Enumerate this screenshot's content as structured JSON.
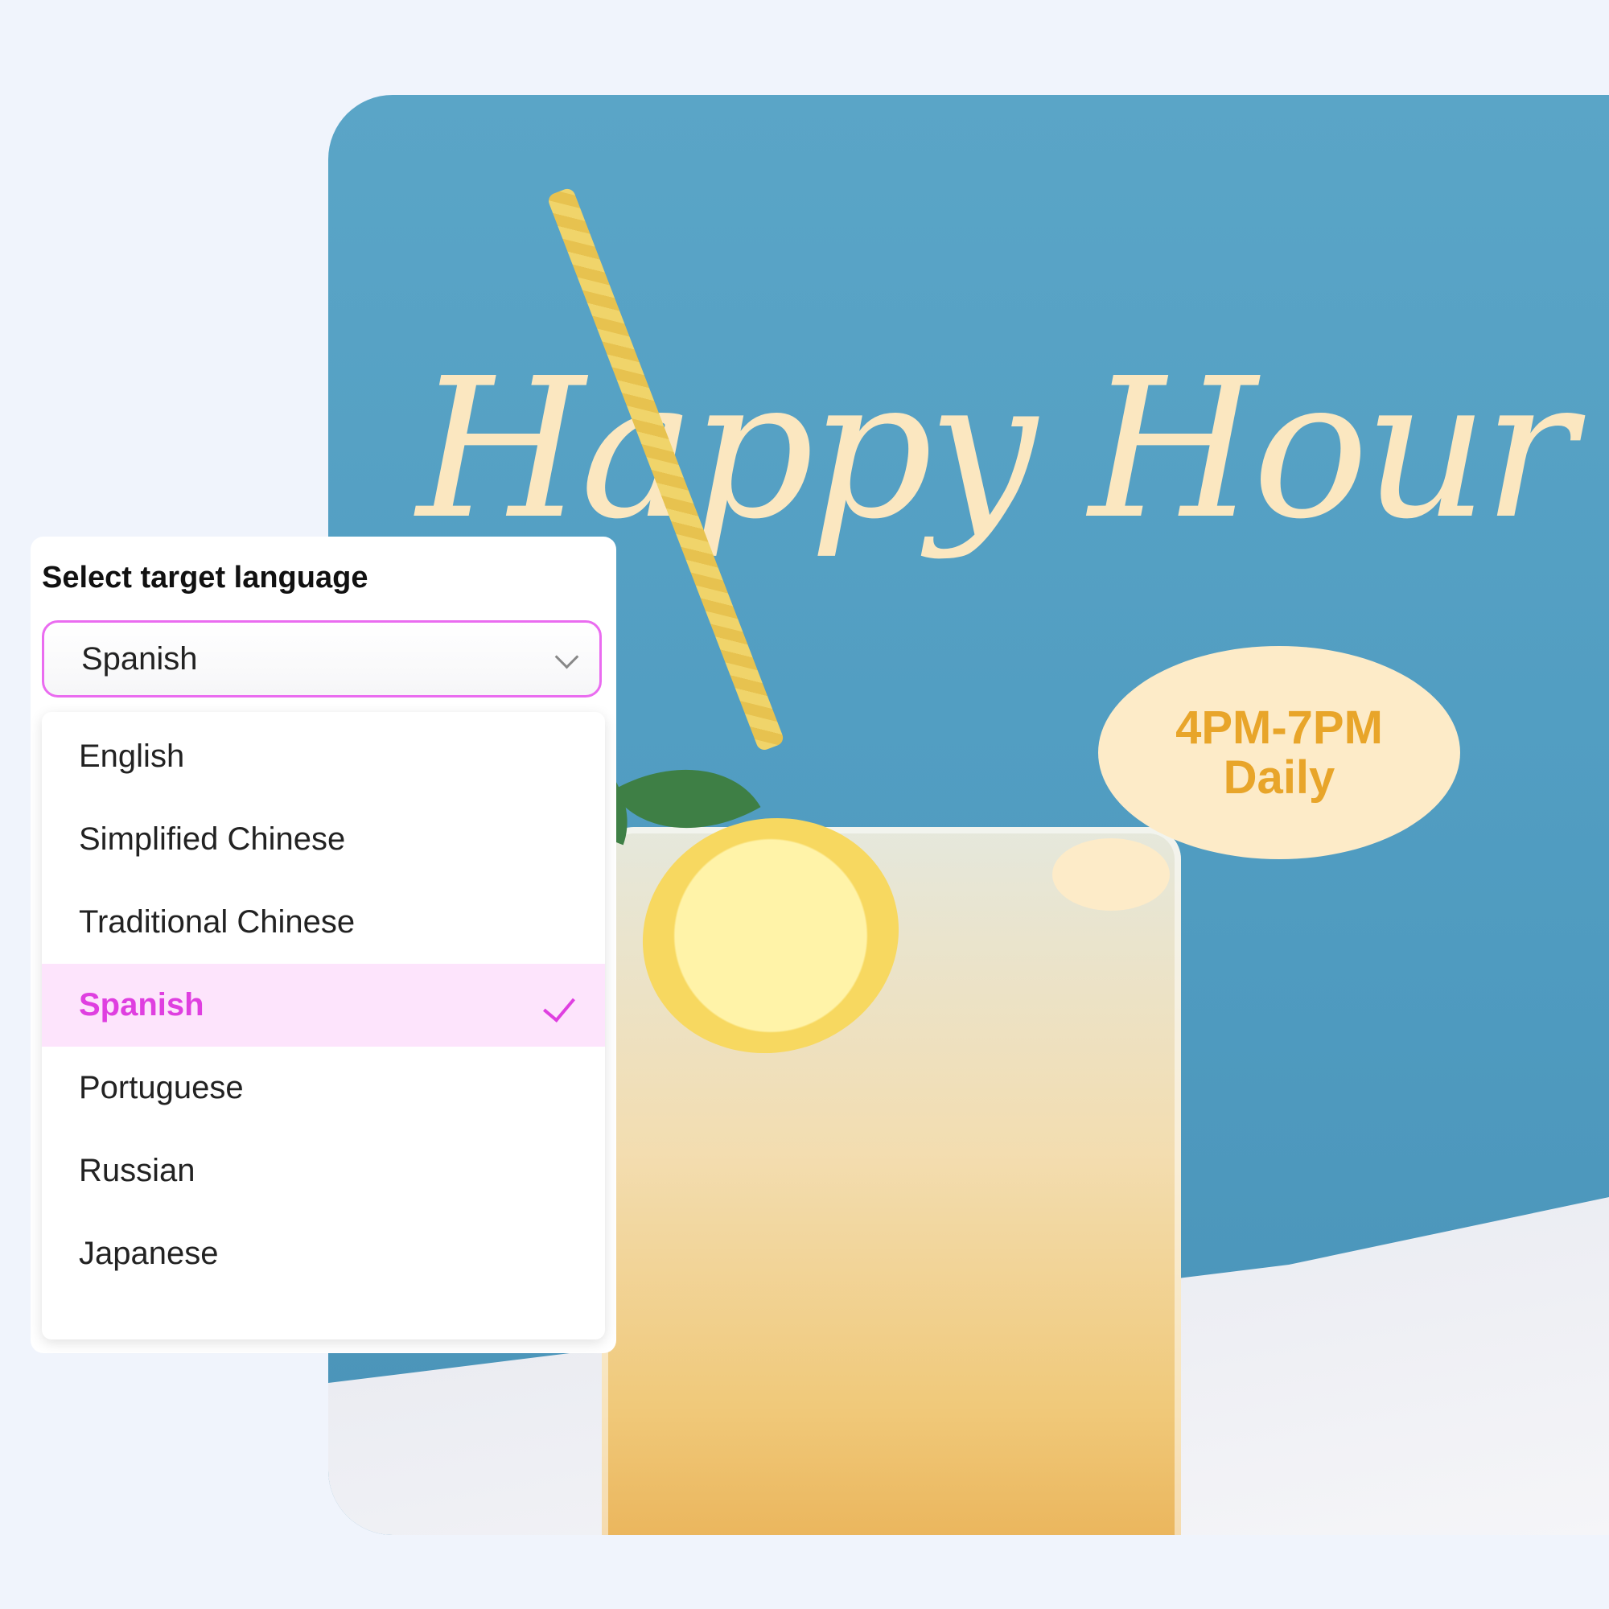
{
  "poster": {
    "headline": "Happy Hour",
    "badge_line1": "4PM-7PM",
    "badge_line2": "Daily"
  },
  "language_selector": {
    "label": "Select target language",
    "selected_value": "Spanish",
    "options": [
      {
        "label": "English",
        "selected": false
      },
      {
        "label": "Simplified Chinese",
        "selected": false
      },
      {
        "label": "Traditional Chinese",
        "selected": false
      },
      {
        "label": "Spanish",
        "selected": true
      },
      {
        "label": "Portuguese",
        "selected": false
      },
      {
        "label": "Russian",
        "selected": false
      },
      {
        "label": "Japanese",
        "selected": false
      }
    ],
    "accent_color": "#df3fe0",
    "selected_bg": "#fde4fc"
  }
}
